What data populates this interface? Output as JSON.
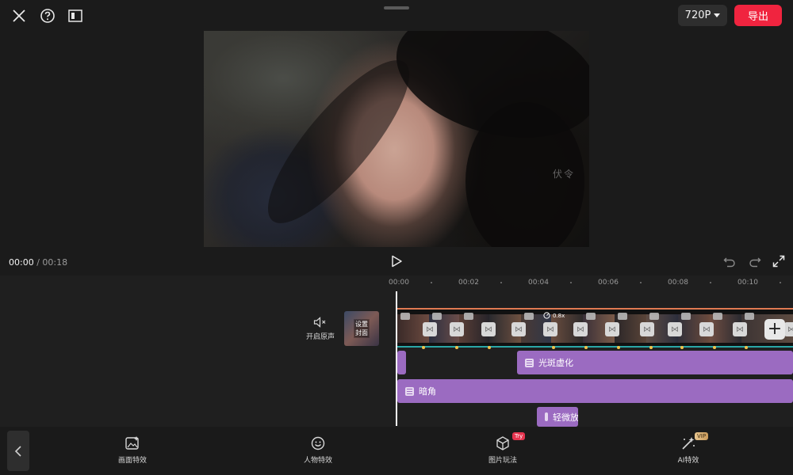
{
  "top_bar": {
    "resolution": "720P",
    "export_label": "导出"
  },
  "preview": {
    "watermark": "伏令"
  },
  "playback": {
    "current_time": "00:00",
    "separator": "/",
    "total_time": "00:18"
  },
  "ruler": {
    "labels": [
      "00:00",
      "00:02",
      "00:04",
      "00:06",
      "00:08",
      "00:10"
    ]
  },
  "track": {
    "mute_label": "开启原声",
    "cover_label_line1": "设置",
    "cover_label_line2": "封面",
    "speed_label": "0.8x"
  },
  "effects": [
    {
      "name": ""
    },
    {
      "name": "光斑虚化"
    },
    {
      "name": "暗角"
    },
    {
      "name": "轻微放"
    }
  ],
  "bottom_tools": [
    {
      "label": "画面特效",
      "icon": "image-sparkle-icon"
    },
    {
      "label": "人物特效",
      "icon": "face-smile-icon"
    },
    {
      "label": "图片玩法",
      "icon": "cube-icon",
      "badge": "Try"
    },
    {
      "label": "AI特效",
      "icon": "magic-wand-icon",
      "badge": "VIP"
    }
  ],
  "colors": {
    "accent_red": "#f0243f",
    "effect_purple": "#9b6bc1",
    "track_border": "#e07a52",
    "keyframe": "#f2c24a"
  }
}
